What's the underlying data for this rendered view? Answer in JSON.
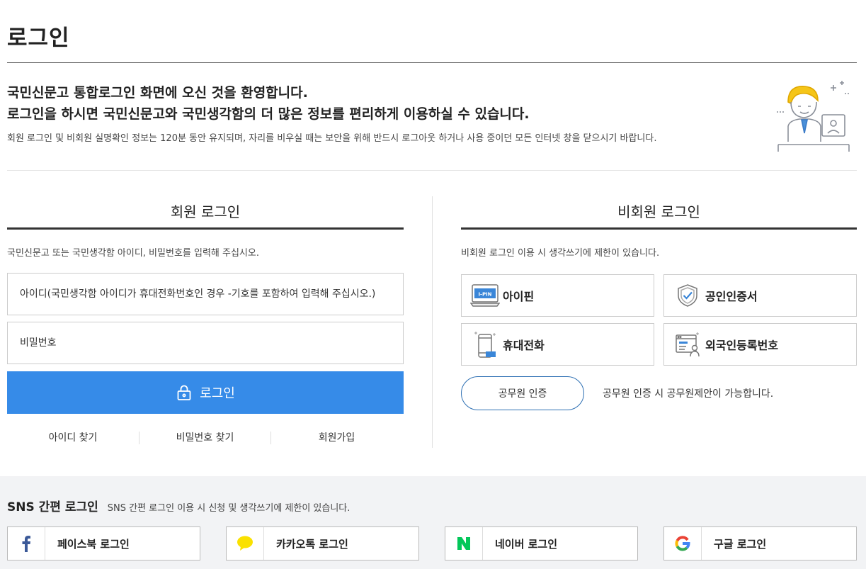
{
  "page": {
    "title": "로그인"
  },
  "welcome": {
    "line1": "국민신문고 통합로그인 화면에 오신 것을 환영합니다.",
    "line2": "로그인을 하시면 국민신문고와 국민생각함의 더 많은 정보를 편리하게 이용하실 수 있습니다.",
    "note": "회원 로그인 및 비회원 실명확인 정보는 120분 동안 유지되며, 자리를 비우실 때는 보안을 위해 반드시 로그아웃 하거나 사용 중이던 모든 인터넷 창을 닫으시기 바랍니다."
  },
  "member": {
    "heading": "회원 로그인",
    "desc": "국민신문고 또는 국민생각함 아이디, 비밀번호를 입력해 주십시오.",
    "id_placeholder": "아이디(국민생각함 아이디가 휴대전화번호인 경우 -기호를 포함하여 입력해 주십시오.)",
    "pw_placeholder": "비밀번호",
    "login_label": "로그인",
    "links": [
      "아이디 찾기",
      "비밀번호 찾기",
      "회원가입"
    ]
  },
  "guest": {
    "heading": "비회원 로그인",
    "desc": "비회원 로그인 이용 시 생각쓰기에 제한이 있습니다.",
    "methods": [
      {
        "label": "아이핀",
        "icon": "ipin-icon",
        "icon_text": "I-PIN"
      },
      {
        "label": "공인인증서",
        "icon": "certificate-shield-icon"
      },
      {
        "label": "휴대전화",
        "icon": "mobile-phone-icon"
      },
      {
        "label": "외국인등록번호",
        "icon": "foreigner-id-card-icon"
      }
    ],
    "gov_label": "공무원 인증",
    "gov_note": "공무원 인증 시 공무원제안이 가능합니다."
  },
  "sns": {
    "title": "SNS 간편 로그인",
    "note": "SNS 간편 로그인 이용 시 신청 및 생각쓰기에 제한이 있습니다.",
    "buttons": [
      {
        "label": "페이스북 로그인",
        "icon": "facebook-icon"
      },
      {
        "label": "카카오톡 로그인",
        "icon": "kakaotalk-icon"
      },
      {
        "label": "네이버 로그인",
        "icon": "naver-icon"
      },
      {
        "label": "구글 로그인",
        "icon": "google-icon"
      }
    ]
  },
  "colors": {
    "primary": "#368be8",
    "gov_border": "#2d6fb3",
    "sns_bg": "#f2f3f5",
    "facebook": "#3b5998",
    "kakao": "#fae100",
    "naver": "#03c75a",
    "illustration_hair": "#f5c518"
  }
}
